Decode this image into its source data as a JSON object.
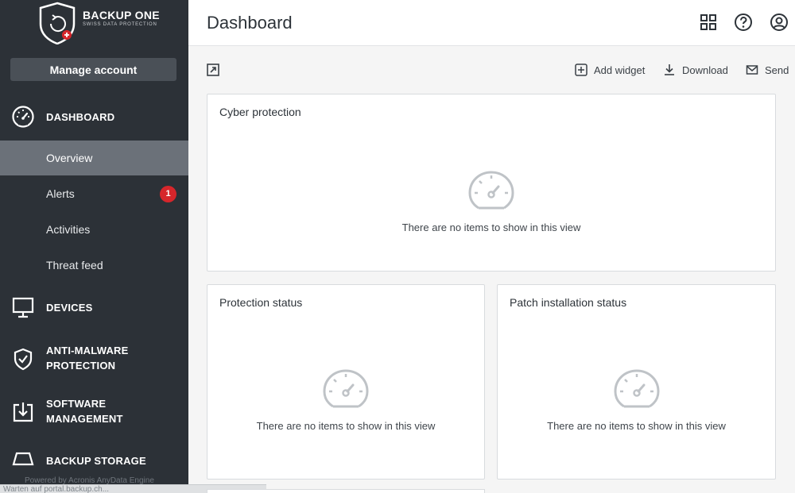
{
  "brand": {
    "name": "BACKUP ONE",
    "tagline": "SWISS DATA PROTECTION"
  },
  "sidebar": {
    "manage_account": "Manage account",
    "sections": [
      {
        "label": "DASHBOARD",
        "icon": "speedometer-icon"
      },
      {
        "label": "DEVICES",
        "icon": "monitor-icon"
      },
      {
        "label": "ANTI-MALWARE PROTECTION",
        "line1": "ANTI-MALWARE",
        "line2": "PROTECTION",
        "icon": "shield-check-icon"
      },
      {
        "label": "SOFTWARE MANAGEMENT",
        "line1": "SOFTWARE",
        "line2": "MANAGEMENT",
        "icon": "install-icon"
      },
      {
        "label": "BACKUP STORAGE",
        "icon": "storage-icon"
      }
    ],
    "dashboard_items": [
      {
        "label": "Overview",
        "active": true
      },
      {
        "label": "Alerts",
        "badge": "1"
      },
      {
        "label": "Activities"
      },
      {
        "label": "Threat feed"
      }
    ],
    "powered_by": "Powered by Acronis AnyData Engine",
    "status_text": "Warten auf portal.backup.ch..."
  },
  "header": {
    "title": "Dashboard",
    "icons": [
      "grid-icon",
      "help-icon",
      "user-icon"
    ]
  },
  "toolbar": {
    "add_widget": "Add widget",
    "download": "Download",
    "send": "Send"
  },
  "widgets": [
    {
      "title": "Cyber protection",
      "empty_text": "There are no items to show in this view"
    },
    {
      "title": "Protection status",
      "empty_text": "There are no items to show in this view"
    },
    {
      "title": "Patch installation status",
      "empty_text": "There are no items to show in this view"
    }
  ],
  "colors": {
    "sidebar_bg": "#2c3137",
    "active_item": "#6b7179",
    "badge": "#d6262b",
    "main_bg": "#f5f5f5"
  }
}
